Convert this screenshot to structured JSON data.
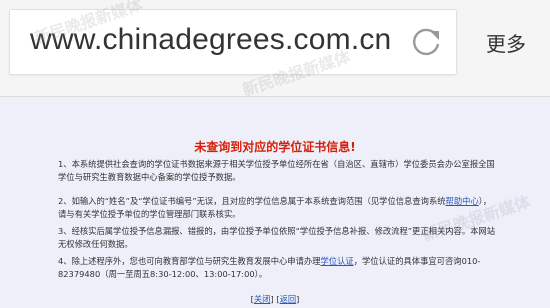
{
  "browser": {
    "url": "www.chinadegrees.com.cn",
    "more_label": "更多",
    "reload_icon": "reload-icon"
  },
  "watermarks": [
    "新民晚报新媒体",
    "新民晚报新媒体",
    "新民晚报新媒体"
  ],
  "content": {
    "title": "未查询到对应的学位证书信息!",
    "p1": "1、本系统提供社会查询的学位证书数据来源于相关学位授予单位经所在省（自治区、直辖市）学位委员会办公室报全国学位与研究生教育数据中心备案的学位授予数据。",
    "p2_before": "2、如输入的“姓名”及“学位证书编号”无误，且对应的学位信息属于本系统查询范围（见学位信息查询系统",
    "p2_link": "帮助中心",
    "p2_after": "），请与有关学位授予单位的学位管理部门联系核实。",
    "p3": "3、经核实后属学位授予信息漏报、错报的，由学位授予单位依照“学位授予信息补报、修改流程”更正相关内容。本网站无权修改任何数据。",
    "p4_before": "4、除上述程序外，您也可向教育部学位与研究生教育发展中心申请办理",
    "p4_link": "学位认证",
    "p4_after": "，学位认证的具体事宜可咨询010-82379480（周一至周五8:30-12:00、13:00-17:00）。"
  },
  "footer": {
    "close": "关闭",
    "back": "返回"
  }
}
